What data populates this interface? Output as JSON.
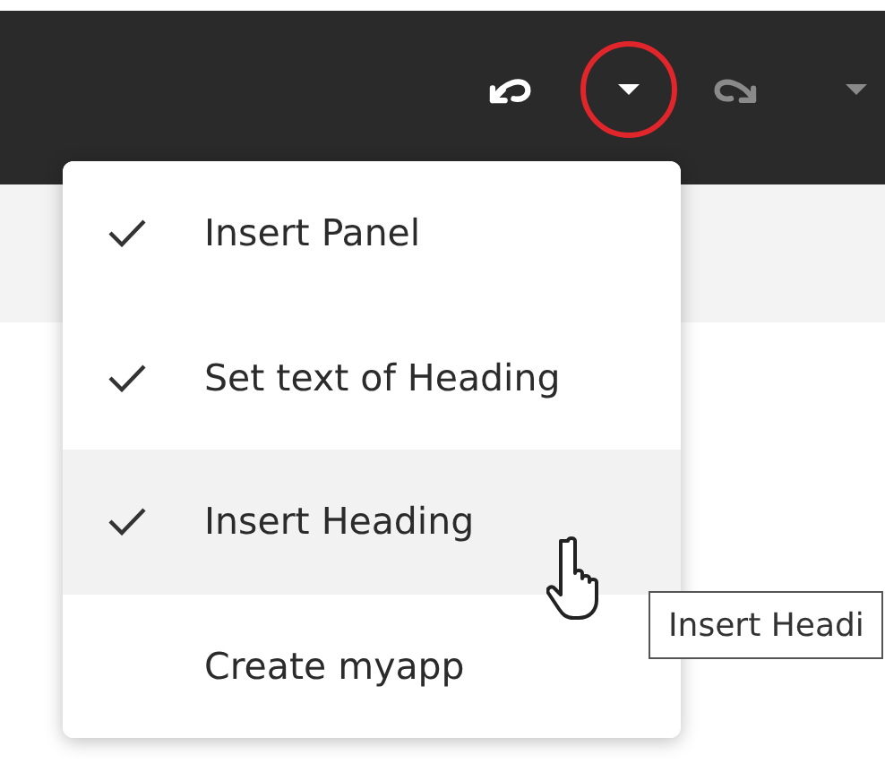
{
  "toolbar": {
    "buttons": [
      {
        "kind": "undo",
        "disabled": false,
        "highlighted": false
      },
      {
        "kind": "dropdown",
        "disabled": false,
        "highlighted": true
      },
      {
        "kind": "redo",
        "disabled": true,
        "highlighted": false
      },
      {
        "kind": "dropdown",
        "disabled": true,
        "highlighted": false
      }
    ]
  },
  "history_menu": {
    "items": [
      {
        "label": "Insert Panel",
        "checked": true,
        "selected": false
      },
      {
        "label": "Set text of Heading",
        "checked": true,
        "selected": false
      },
      {
        "label": "Insert Heading",
        "checked": true,
        "selected": true
      },
      {
        "label": "Create myapp",
        "checked": false,
        "selected": false
      }
    ]
  },
  "tooltip": {
    "text": "Insert Headi"
  }
}
